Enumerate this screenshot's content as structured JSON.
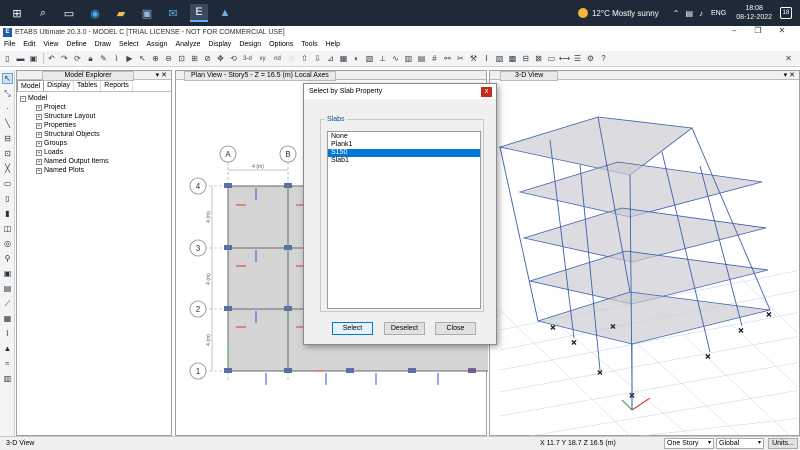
{
  "taskbar": {
    "weather": "12°C  Mostly sunny",
    "language": "ENG",
    "time": "18:08",
    "date": "08-12-2022",
    "notifications": "18"
  },
  "window": {
    "title": "ETABS Ultimate 20.3.0 - MODEL C  [TRIAL LICENSE - NOT FOR COMMERCIAL USE]",
    "app_icon_letter": "E"
  },
  "menu": [
    "File",
    "Edit",
    "View",
    "Define",
    "Draw",
    "Select",
    "Assign",
    "Analyze",
    "Display",
    "Design",
    "Options",
    "Tools",
    "Help"
  ],
  "toolbar": {
    "view_3d_label": "3-d",
    "view_plan_label": "xy",
    "view_nd_label": "nd"
  },
  "explorer": {
    "title": "Model Explorer",
    "tabs": [
      "Model",
      "Display",
      "Tables",
      "Reports"
    ],
    "root": "Model",
    "items": [
      "Project",
      "Structure Layout",
      "Properties",
      "Structural Objects",
      "Groups",
      "Loads",
      "Named Output Items",
      "Named Plots"
    ]
  },
  "planview": {
    "title": "Plan View - Story5 - Z = 16.5 (m)  Local Axes",
    "grid_cols": [
      "A",
      "B"
    ],
    "grid_rows": [
      "4",
      "3",
      "2",
      "1"
    ],
    "dim_horizontal": "4 (m)",
    "dim_vertical": "4 (m)"
  },
  "view3d": {
    "title": "3-D View"
  },
  "dialog": {
    "title": "Select by Slab Property",
    "close_glyph": "x",
    "group_label": "Slabs",
    "options": [
      "None",
      "Plank1",
      "S150",
      "Slab1"
    ],
    "selected_option": "S150",
    "buttons": {
      "select": "Select",
      "deselect": "Deselect",
      "close": "Close"
    }
  },
  "status": {
    "left": "3-D View",
    "coords": "X 11.7  Y 18.7  Z 16.5 (m)",
    "story_mode": "One Story",
    "coord_system": "Global",
    "units_button": "Units..."
  }
}
